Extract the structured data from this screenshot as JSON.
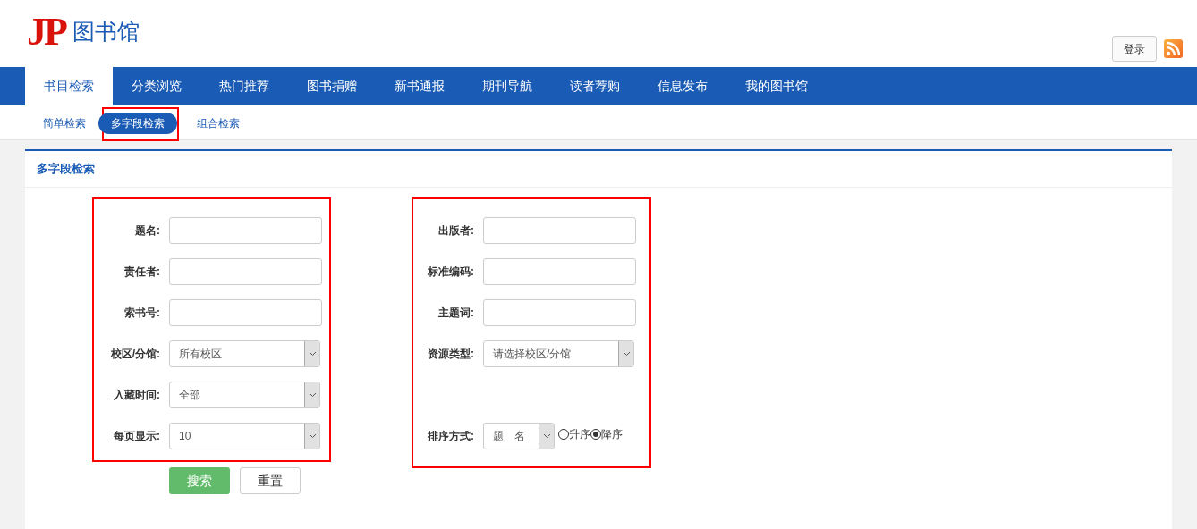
{
  "logo": {
    "mark": "JP",
    "title": "图书馆"
  },
  "login_button": "登录",
  "nav": [
    {
      "label": "书目检索",
      "selected": true
    },
    {
      "label": "分类浏览",
      "selected": false
    },
    {
      "label": "热门推荐",
      "selected": false
    },
    {
      "label": "图书捐赠",
      "selected": false
    },
    {
      "label": "新书通报",
      "selected": false
    },
    {
      "label": "期刊导航",
      "selected": false
    },
    {
      "label": "读者荐购",
      "selected": false
    },
    {
      "label": "信息发布",
      "selected": false
    },
    {
      "label": "我的图书馆",
      "selected": false
    }
  ],
  "subnav": [
    {
      "label": "简单检索",
      "selected": false,
      "highlighted": false
    },
    {
      "label": "多字段检索",
      "selected": true,
      "highlighted": true
    },
    {
      "label": "组合检索",
      "selected": false,
      "highlighted": false
    }
  ],
  "panel": {
    "title": "多字段检索",
    "left_fields": [
      {
        "label": "题名:",
        "kind": "text"
      },
      {
        "label": "责任者:",
        "kind": "text"
      },
      {
        "label": "索书号:",
        "kind": "text"
      },
      {
        "label": "校区/分馆:",
        "kind": "select",
        "value": "所有校区"
      },
      {
        "label": "入藏时间:",
        "kind": "select",
        "value": "全部"
      },
      {
        "label": "每页显示:",
        "kind": "select",
        "value": "10"
      }
    ],
    "right_fields": [
      {
        "label": "出版者:",
        "kind": "text"
      },
      {
        "label": "标准编码:",
        "kind": "text"
      },
      {
        "label": "主题词:",
        "kind": "text"
      },
      {
        "label": "资源类型:",
        "kind": "select",
        "value": "请选择校区/分馆"
      },
      {
        "kind": "spacer"
      }
    ],
    "sort": {
      "label": "排序方式:",
      "value": "题　名",
      "orders": [
        {
          "label": "升序",
          "selected": false
        },
        {
          "label": "降序",
          "selected": true
        }
      ]
    },
    "buttons": [
      {
        "label": "搜索",
        "kind": "primary"
      },
      {
        "label": "重置",
        "kind": "default"
      }
    ]
  }
}
